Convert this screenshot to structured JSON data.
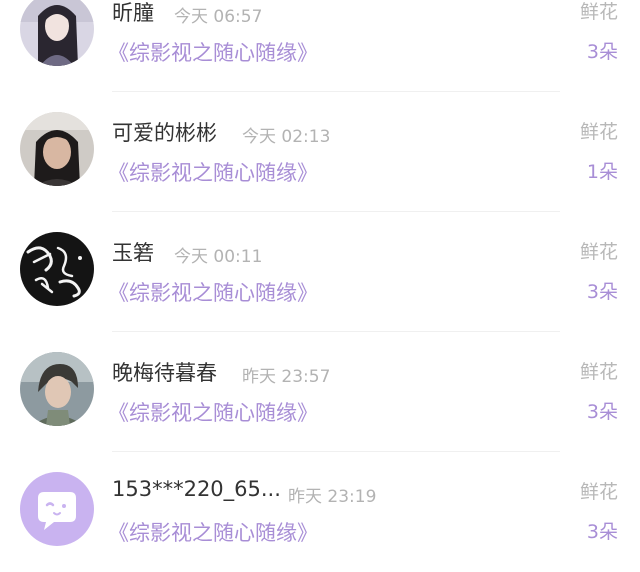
{
  "rows": [
    {
      "name": "昕朣",
      "time": "今天 06:57",
      "book": "《综影视之随心随缘》",
      "gift_label": "鲜花",
      "count": "3朵",
      "avatar": "avatar-girl-dark-hair"
    },
    {
      "name": "可爱的彬彬",
      "time": "今天 02:13",
      "book": "《综影视之随心随缘》",
      "gift_label": "鲜花",
      "count": "1朵",
      "avatar": "avatar-photo-person"
    },
    {
      "name": "玉箬",
      "time": "今天 00:11",
      "book": "《综影视之随心随缘》",
      "gift_label": "鲜花",
      "count": "3朵",
      "avatar": "avatar-calligraphy"
    },
    {
      "name": "晚梅待暮春",
      "time": "昨天 23:57",
      "book": "《综影视之随心随缘》",
      "gift_label": "鲜花",
      "count": "3朵",
      "avatar": "avatar-photo-man"
    },
    {
      "name": "153***220_65...",
      "time": "昨天 23:19",
      "book": "《综影视之随心随缘》",
      "gift_label": "鲜花",
      "count": "3朵",
      "avatar": "avatar-default-chat-icon"
    }
  ],
  "colors": {
    "accent": "#a88ed6",
    "name": "#333333",
    "muted": "#b3b3b3",
    "default_avatar_bg": "#c9b3f0"
  }
}
